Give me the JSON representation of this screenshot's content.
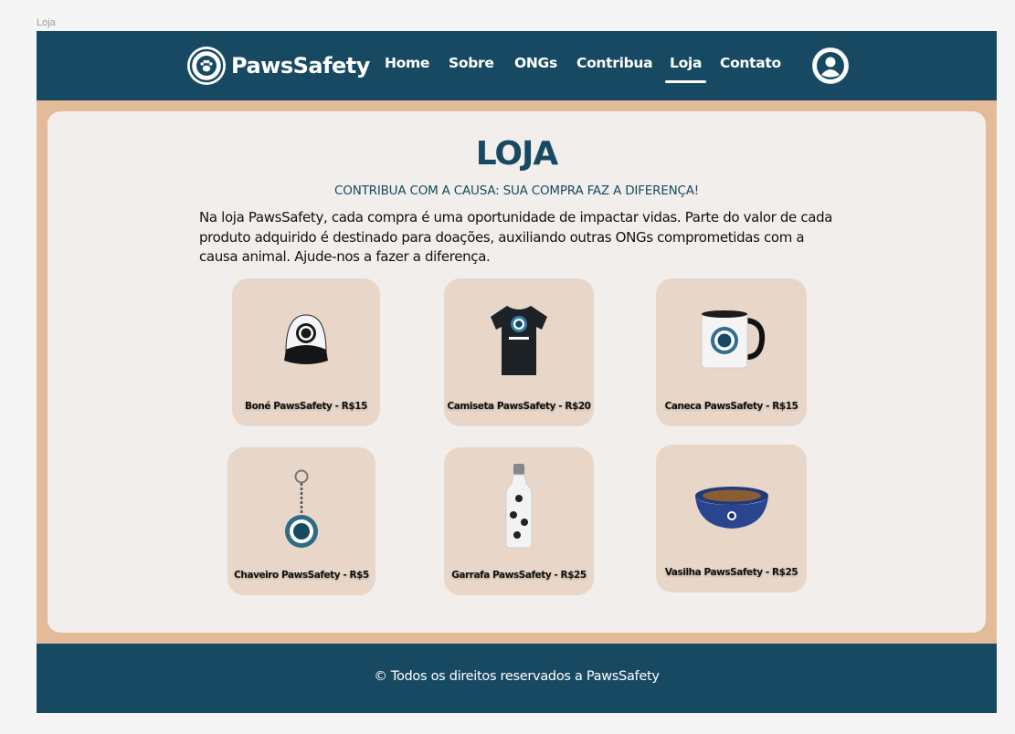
{
  "frame_label": "Loja",
  "header": {
    "brand": "PawsSafety",
    "nav": [
      {
        "label": "Home"
      },
      {
        "label": "Sobre"
      },
      {
        "label": "ONGs"
      },
      {
        "label": "Contribua"
      },
      {
        "label": "Loja",
        "active": true
      },
      {
        "label": "Contato"
      }
    ]
  },
  "main": {
    "title": "LOJA",
    "subtitle": "CONTRIBUA COM A CAUSA: SUA COMPRA FAZ A DIFERENÇA!",
    "intro": "Na loja PawsSafety, cada compra é uma oportunidade de impactar vidas. Parte do valor de cada produto adquirido é destinado para doações, auxiliando outras ONGs comprometidas com a causa animal. Ajude-nos a fazer a diferença.",
    "products": [
      {
        "label": "Boné PawsSafety - R$15",
        "icon": "cap-icon"
      },
      {
        "label": "Camiseta PawsSafety - R$20",
        "icon": "tshirt-icon"
      },
      {
        "label": "Caneca PawsSafety - R$15",
        "icon": "mug-icon"
      },
      {
        "label": "Chaveiro PawsSafety - R$5",
        "icon": "keychain-icon"
      },
      {
        "label": "Garrafa PawsSafety - R$25",
        "icon": "bottle-icon"
      },
      {
        "label": "Vasilha PawsSafety - R$25",
        "icon": "bowl-icon"
      }
    ]
  },
  "footer": {
    "text": "© Todos os direitos reservados a PawsSafety"
  },
  "colors": {
    "primary": "#174a62",
    "frame_bg": "#e3bb99",
    "content_bg": "#f2eeeb",
    "card_bg": "#e8d7c8"
  }
}
